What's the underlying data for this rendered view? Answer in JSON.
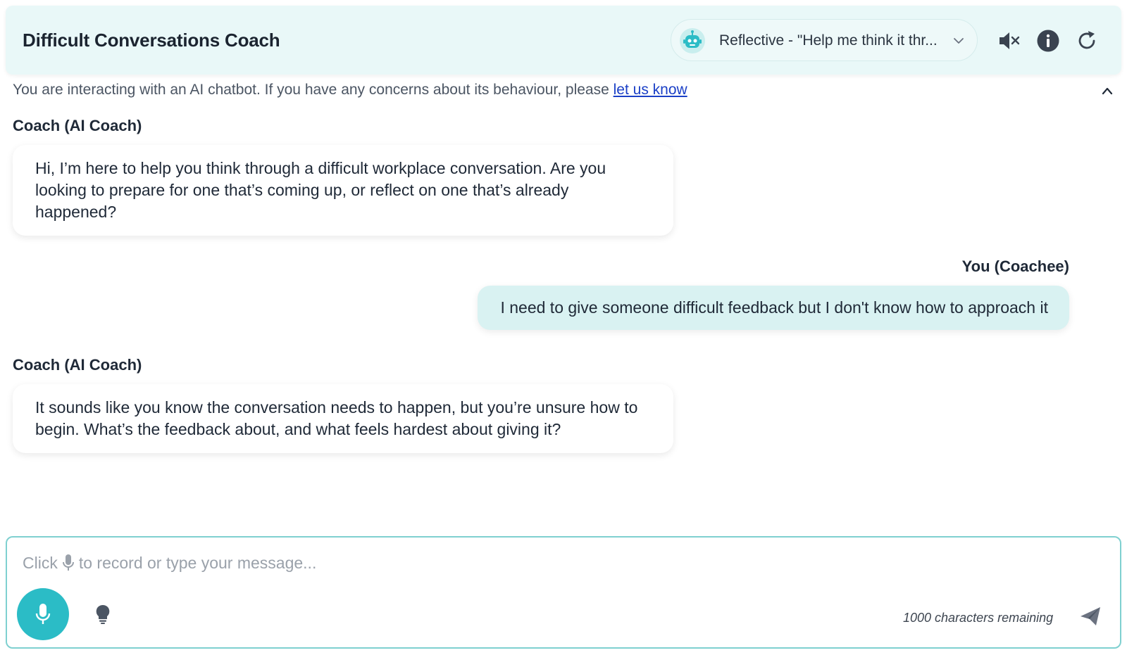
{
  "header": {
    "title": "Difficult Conversations Coach",
    "mode_label": "Reflective - \"Help me think it thr...",
    "icons": [
      "robot-icon",
      "chevron-down-icon",
      "mute-icon",
      "info-icon",
      "refresh-icon"
    ]
  },
  "notice": {
    "text": "You are interacting with an AI chatbot. If you have any concerns about its behaviour, please ",
    "link_text": "let us know"
  },
  "messages": [
    {
      "sender": "Coach (AI Coach)",
      "role": "coach",
      "text": "Hi, I’m here to help you think through a difficult workplace conversation. Are you looking to prepare for one that’s coming up, or reflect on one that’s already happened?"
    },
    {
      "sender": "You (Coachee)",
      "role": "user",
      "text": "I need to give someone difficult feedback but I don't know how to approach it"
    },
    {
      "sender": "Coach (AI Coach)",
      "role": "coach",
      "text": "It sounds like you know the conversation needs to happen, but you’re unsure how to begin. What’s the feedback about, and what feels hardest about giving it?"
    }
  ],
  "composer": {
    "placeholder_prefix": "Click",
    "placeholder_suffix": "to record or type your message...",
    "char_count": "1000 characters remaining"
  },
  "colors": {
    "accent": "#2bbcc6",
    "header_bg": "#e9f8f8",
    "user_bubble": "#d9f2f2",
    "link": "#1a3fc6"
  }
}
